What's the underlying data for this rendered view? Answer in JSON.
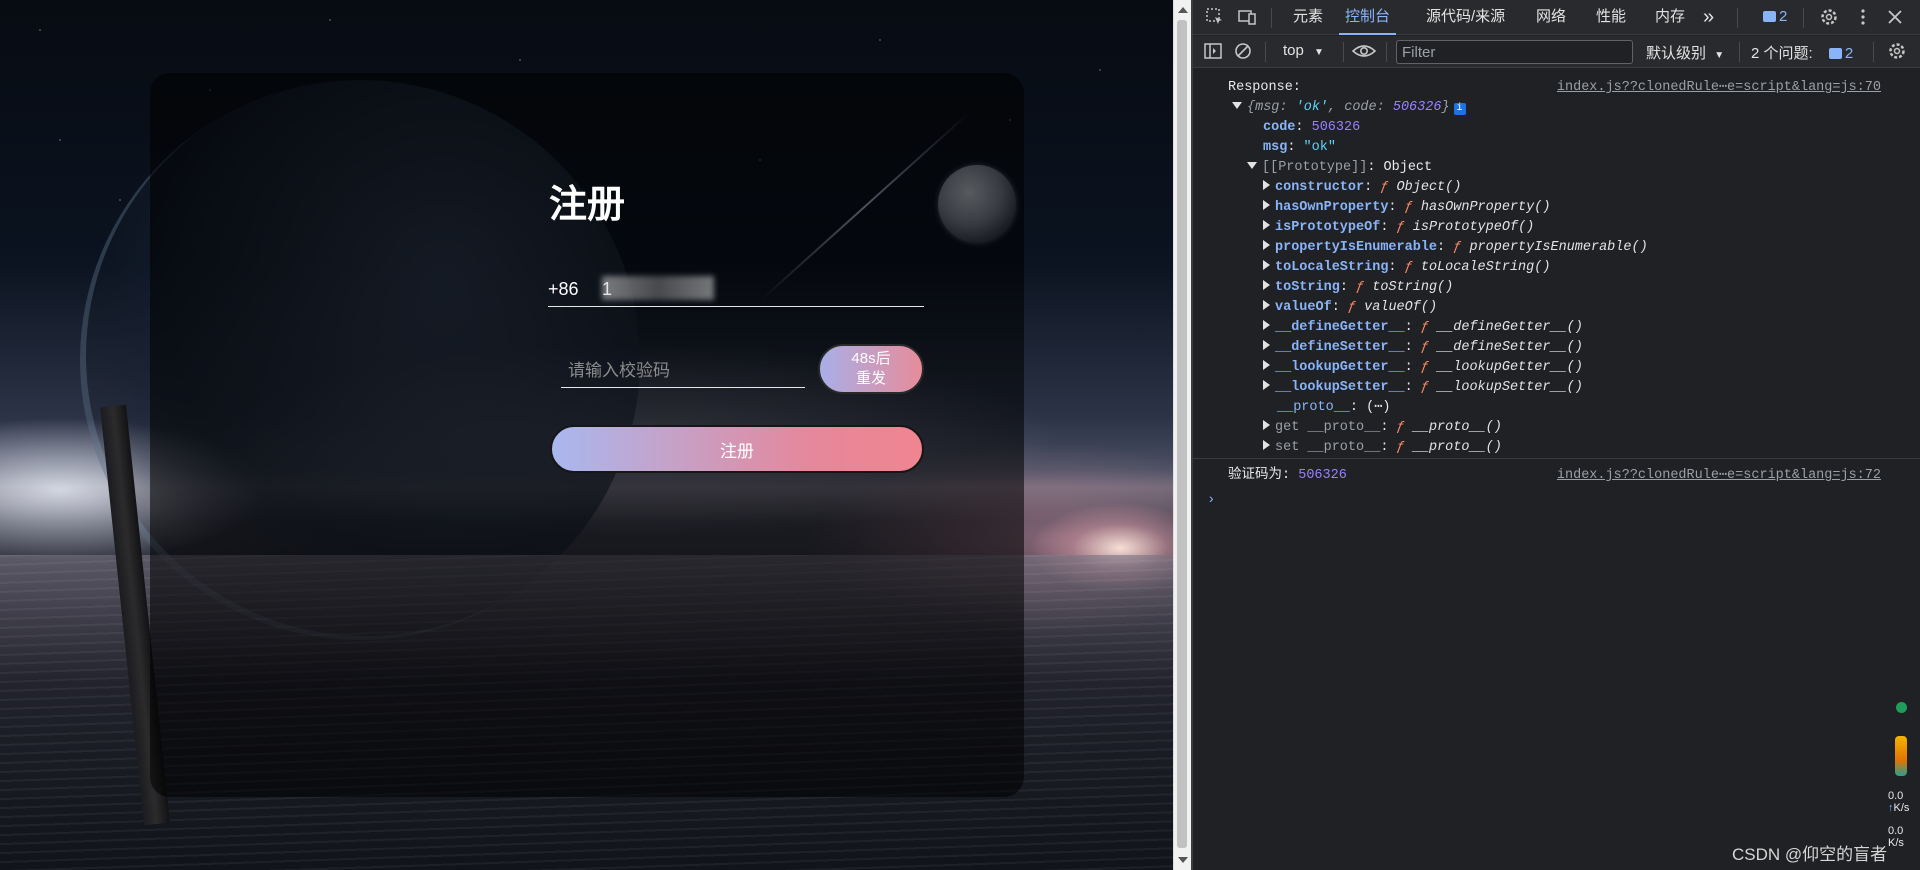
{
  "page": {
    "title": "注册",
    "country_code": "+86",
    "phone_value": "1",
    "code_placeholder": "请输入校验码",
    "resend_line1": "48s后",
    "resend_line2": "重发",
    "register_label": "注册"
  },
  "devtools": {
    "tabs": [
      "元素",
      "控制台",
      "源代码/来源",
      "网络",
      "性能",
      "内存"
    ],
    "active_tab": "控制台",
    "more_tabs": "»",
    "issue_badge_count": "2",
    "context": "top",
    "filter_placeholder": "Filter",
    "level": "默认级别",
    "issues_label": "2 个问题:",
    "issues_count": "2"
  },
  "console": {
    "response_label": "Response:",
    "source1": "index.js??clonedRule⋯e=script&lang=js:70",
    "summary_open": "{",
    "summary_k1": "msg",
    "summary_v1": "'ok'",
    "summary_k2": "code",
    "summary_v2": "506326",
    "summary_close": "}",
    "code_key": "code",
    "code_val": "506326",
    "msg_key": "msg",
    "msg_val": "\"ok\"",
    "proto_key": "[[Prototype]]",
    "proto_val": "Object",
    "proto_members": [
      {
        "key": "constructor",
        "fn": "Object()"
      },
      {
        "key": "hasOwnProperty",
        "fn": "hasOwnProperty()"
      },
      {
        "key": "isPrototypeOf",
        "fn": "isPrototypeOf()"
      },
      {
        "key": "propertyIsEnumerable",
        "fn": "propertyIsEnumerable()"
      },
      {
        "key": "toLocaleString",
        "fn": "toLocaleString()"
      },
      {
        "key": "toString",
        "fn": "toString()"
      },
      {
        "key": "valueOf",
        "fn": "valueOf()"
      },
      {
        "key": "__defineGetter__",
        "fn": "__defineGetter__()"
      },
      {
        "key": "__defineSetter__",
        "fn": "__defineSetter__()"
      },
      {
        "key": "__lookupGetter__",
        "fn": "__lookupGetter__()"
      },
      {
        "key": "__lookupSetter__",
        "fn": "__lookupSetter__()"
      }
    ],
    "proto_getter_key": "__proto__",
    "proto_getter_val": "(⋯)",
    "get_proto_key": "get __proto__",
    "get_proto_fn": "__proto__()",
    "set_proto_key": "set __proto__",
    "set_proto_fn": "__proto__()",
    "fn_marker": "ƒ",
    "verify_label": "验证码为:",
    "verify_code": "506326",
    "source2": "index.js??clonedRule⋯e=script&lang=js:72",
    "prompt": "›"
  },
  "side_panel": {
    "speed1": "0.0",
    "speed1_unit": "K/s",
    "speed2": "0.0",
    "speed2_unit": "K/s"
  },
  "watermark": "CSDN @仰空的盲者",
  "colors": {
    "accent": "#8ab4f8",
    "button_gradient_start": "#a9b8ef",
    "button_gradient_end": "#ef8590"
  }
}
